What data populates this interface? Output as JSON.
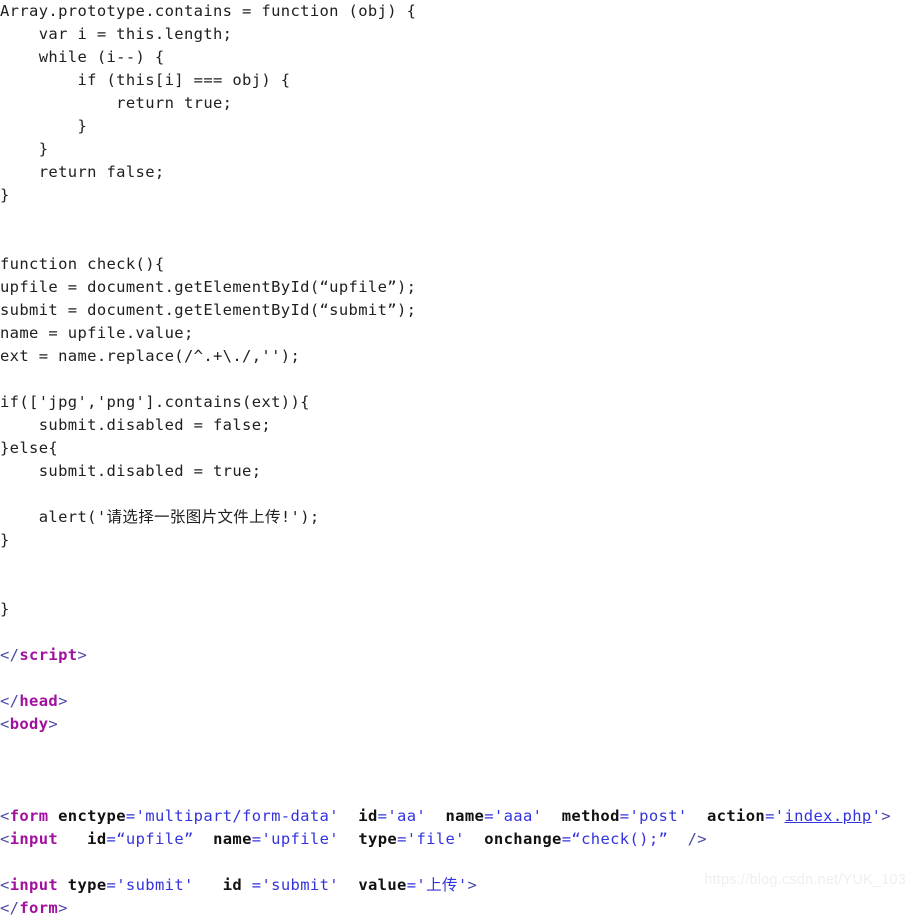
{
  "page": {
    "background_color": "#ffffff",
    "text_color": "#202020",
    "kind": "code-listing-screenshot"
  },
  "colors": {
    "plain": "#202020",
    "angle_bracket": "#4a4aa8",
    "tag_name": "#a0119e",
    "attribute_name": "#111111",
    "attribute_value": "#3333dd",
    "link_value": "#3333dd",
    "watermark": "#efefef"
  },
  "watermark": {
    "text": "https://blog.csdn.net/YUK_103"
  },
  "code": {
    "language": "html-with-javascript",
    "lines": [
      {
        "id": "l01",
        "segments": [
          {
            "t": "Array.prototype.contains = function (obj) {",
            "c": "tok-plain"
          }
        ]
      },
      {
        "id": "l02",
        "segments": [
          {
            "t": "    var i = this.length;",
            "c": "tok-plain"
          }
        ]
      },
      {
        "id": "l03",
        "segments": [
          {
            "t": "    while (i--) {",
            "c": "tok-plain"
          }
        ]
      },
      {
        "id": "l04",
        "segments": [
          {
            "t": "        if (this[i] === obj) {",
            "c": "tok-plain"
          }
        ]
      },
      {
        "id": "l05",
        "segments": [
          {
            "t": "            return true;",
            "c": "tok-plain"
          }
        ]
      },
      {
        "id": "l06",
        "segments": [
          {
            "t": "        }",
            "c": "tok-plain"
          }
        ]
      },
      {
        "id": "l07",
        "segments": [
          {
            "t": "    }",
            "c": "tok-plain"
          }
        ]
      },
      {
        "id": "l08",
        "segments": [
          {
            "t": "    return false;",
            "c": "tok-plain"
          }
        ]
      },
      {
        "id": "l09",
        "segments": [
          {
            "t": "}",
            "c": "tok-plain"
          }
        ]
      },
      {
        "id": "l10",
        "segments": [
          {
            "t": "",
            "c": "tok-plain"
          }
        ]
      },
      {
        "id": "l11",
        "segments": [
          {
            "t": "",
            "c": "tok-plain"
          }
        ]
      },
      {
        "id": "l12",
        "segments": [
          {
            "t": "function check(){",
            "c": "tok-plain"
          }
        ]
      },
      {
        "id": "l13",
        "segments": [
          {
            "t": "upfile = document.getElementById(“upfile”);",
            "c": "tok-plain"
          }
        ]
      },
      {
        "id": "l14",
        "segments": [
          {
            "t": "submit = document.getElementById(“submit”);",
            "c": "tok-plain"
          }
        ]
      },
      {
        "id": "l15",
        "segments": [
          {
            "t": "name = upfile.value;",
            "c": "tok-plain"
          }
        ]
      },
      {
        "id": "l16",
        "segments": [
          {
            "t": "ext = name.replace(/^.+\\./,'');",
            "c": "tok-plain"
          }
        ]
      },
      {
        "id": "l17",
        "segments": [
          {
            "t": "",
            "c": "tok-plain"
          }
        ]
      },
      {
        "id": "l18",
        "segments": [
          {
            "t": "if(['jpg','png'].contains(ext)){",
            "c": "tok-plain"
          }
        ]
      },
      {
        "id": "l19",
        "segments": [
          {
            "t": "    submit.disabled = false;",
            "c": "tok-plain"
          }
        ]
      },
      {
        "id": "l20",
        "segments": [
          {
            "t": "}else{",
            "c": "tok-plain"
          }
        ]
      },
      {
        "id": "l21",
        "segments": [
          {
            "t": "    submit.disabled = true;",
            "c": "tok-plain"
          }
        ]
      },
      {
        "id": "l22",
        "segments": [
          {
            "t": "",
            "c": "tok-plain"
          }
        ]
      },
      {
        "id": "l23",
        "segments": [
          {
            "t": "    alert('",
            "c": "tok-plain"
          },
          {
            "t": "请选择一张图片文件上传",
            "c": "cjk-plain"
          },
          {
            "t": "!');",
            "c": "tok-plain"
          }
        ]
      },
      {
        "id": "l24",
        "segments": [
          {
            "t": "}",
            "c": "tok-plain"
          }
        ]
      },
      {
        "id": "l25",
        "segments": [
          {
            "t": "",
            "c": "tok-plain"
          }
        ]
      },
      {
        "id": "l26",
        "segments": [
          {
            "t": "",
            "c": "tok-plain"
          }
        ]
      },
      {
        "id": "l27",
        "segments": [
          {
            "t": "}",
            "c": "tok-plain"
          }
        ]
      },
      {
        "id": "l28",
        "segments": [
          {
            "t": "",
            "c": "tok-plain"
          }
        ]
      },
      {
        "id": "l29",
        "segments": [
          {
            "t": "</",
            "c": "tok-bracket"
          },
          {
            "t": "script",
            "c": "tok-tag"
          },
          {
            "t": ">",
            "c": "tok-bracket"
          }
        ]
      },
      {
        "id": "l30",
        "segments": [
          {
            "t": "",
            "c": "tok-plain"
          }
        ]
      },
      {
        "id": "l31",
        "segments": [
          {
            "t": "</",
            "c": "tok-bracket"
          },
          {
            "t": "head",
            "c": "tok-tag"
          },
          {
            "t": ">",
            "c": "tok-bracket"
          }
        ]
      },
      {
        "id": "l32",
        "segments": [
          {
            "t": "<",
            "c": "tok-bracket"
          },
          {
            "t": "body",
            "c": "tok-tag"
          },
          {
            "t": ">",
            "c": "tok-bracket"
          }
        ]
      },
      {
        "id": "l33",
        "segments": [
          {
            "t": "",
            "c": "tok-plain"
          }
        ]
      },
      {
        "id": "l34",
        "segments": [
          {
            "t": "",
            "c": "tok-plain"
          }
        ]
      },
      {
        "id": "l35",
        "segments": [
          {
            "t": "",
            "c": "tok-plain"
          }
        ]
      },
      {
        "id": "l36",
        "segments": [
          {
            "t": "<",
            "c": "tok-bracket"
          },
          {
            "t": "form",
            "c": "tok-tag"
          },
          {
            "t": " ",
            "c": "tok-plain"
          },
          {
            "t": "enctype",
            "c": "tok-attr"
          },
          {
            "t": "='",
            "c": "tok-value"
          },
          {
            "t": "multipart/form-data",
            "c": "tok-value"
          },
          {
            "t": "'",
            "c": "tok-value"
          },
          {
            "t": "  ",
            "c": "tok-plain"
          },
          {
            "t": "id",
            "c": "tok-attr"
          },
          {
            "t": "='",
            "c": "tok-value"
          },
          {
            "t": "aa",
            "c": "tok-value"
          },
          {
            "t": "'",
            "c": "tok-value"
          },
          {
            "t": "  ",
            "c": "tok-plain"
          },
          {
            "t": "name",
            "c": "tok-attr"
          },
          {
            "t": "='",
            "c": "tok-value"
          },
          {
            "t": "aaa",
            "c": "tok-value"
          },
          {
            "t": "'",
            "c": "tok-value"
          },
          {
            "t": "  ",
            "c": "tok-plain"
          },
          {
            "t": "method",
            "c": "tok-attr"
          },
          {
            "t": "='",
            "c": "tok-value"
          },
          {
            "t": "post",
            "c": "tok-value"
          },
          {
            "t": "'",
            "c": "tok-value"
          },
          {
            "t": "  ",
            "c": "tok-plain"
          },
          {
            "t": "action",
            "c": "tok-attr"
          },
          {
            "t": "='",
            "c": "tok-value"
          },
          {
            "t": "index.php",
            "c": "tok-link"
          },
          {
            "t": "'",
            "c": "tok-value"
          },
          {
            "t": ">",
            "c": "tok-bracket"
          }
        ]
      },
      {
        "id": "l37",
        "segments": [
          {
            "t": "<",
            "c": "tok-bracket"
          },
          {
            "t": "input",
            "c": "tok-tag"
          },
          {
            "t": "   ",
            "c": "tok-plain"
          },
          {
            "t": "id",
            "c": "tok-attr"
          },
          {
            "t": "=“",
            "c": "tok-value"
          },
          {
            "t": "upfile",
            "c": "tok-value"
          },
          {
            "t": "”",
            "c": "tok-value"
          },
          {
            "t": "  ",
            "c": "tok-plain"
          },
          {
            "t": "name",
            "c": "tok-attr"
          },
          {
            "t": "='",
            "c": "tok-value"
          },
          {
            "t": "upfile",
            "c": "tok-value"
          },
          {
            "t": "'",
            "c": "tok-value"
          },
          {
            "t": "  ",
            "c": "tok-plain"
          },
          {
            "t": "type",
            "c": "tok-attr"
          },
          {
            "t": "='",
            "c": "tok-value"
          },
          {
            "t": "file",
            "c": "tok-value"
          },
          {
            "t": "'",
            "c": "tok-value"
          },
          {
            "t": "  ",
            "c": "tok-plain"
          },
          {
            "t": "onchange",
            "c": "tok-attr"
          },
          {
            "t": "=“",
            "c": "tok-value"
          },
          {
            "t": "check();",
            "c": "tok-value"
          },
          {
            "t": "”",
            "c": "tok-value"
          },
          {
            "t": "  ",
            "c": "tok-plain"
          },
          {
            "t": "/>",
            "c": "tok-bracket"
          }
        ]
      },
      {
        "id": "l38",
        "segments": [
          {
            "t": "",
            "c": "tok-plain"
          }
        ]
      },
      {
        "id": "l39",
        "segments": [
          {
            "t": "<",
            "c": "tok-bracket"
          },
          {
            "t": "input",
            "c": "tok-tag"
          },
          {
            "t": " ",
            "c": "tok-plain"
          },
          {
            "t": "type",
            "c": "tok-attr"
          },
          {
            "t": "='",
            "c": "tok-value"
          },
          {
            "t": "submit",
            "c": "tok-value"
          },
          {
            "t": "'",
            "c": "tok-value"
          },
          {
            "t": "   ",
            "c": "tok-plain"
          },
          {
            "t": "id",
            "c": "tok-attr"
          },
          {
            "t": " ='",
            "c": "tok-value"
          },
          {
            "t": "submit",
            "c": "tok-value"
          },
          {
            "t": "'",
            "c": "tok-value"
          },
          {
            "t": "  ",
            "c": "tok-plain"
          },
          {
            "t": "value",
            "c": "tok-attr"
          },
          {
            "t": "='",
            "c": "tok-value"
          },
          {
            "t": "上传",
            "c": "tok-cjk"
          },
          {
            "t": "'",
            "c": "tok-value"
          },
          {
            "t": ">",
            "c": "tok-bracket"
          }
        ]
      },
      {
        "id": "l40",
        "segments": [
          {
            "t": "</",
            "c": "tok-bracket"
          },
          {
            "t": "form",
            "c": "tok-tag"
          },
          {
            "t": ">",
            "c": "tok-bracket"
          }
        ]
      }
    ]
  }
}
